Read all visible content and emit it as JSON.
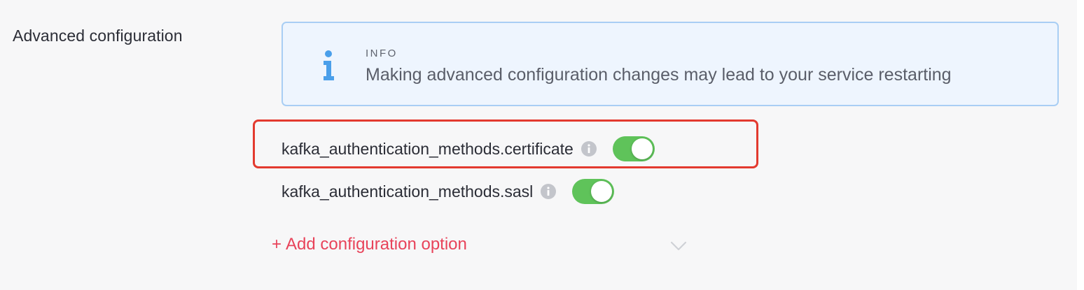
{
  "section": {
    "label": "Advanced configuration"
  },
  "info": {
    "title": "INFO",
    "message": "Making advanced configuration changes may lead to your service restarting",
    "icon": "info-icon"
  },
  "options": [
    {
      "label": "kafka_authentication_methods.certificate",
      "enabled": true,
      "hint_icon": "info-circle-icon"
    },
    {
      "label": "kafka_authentication_methods.sasl",
      "enabled": true,
      "hint_icon": "info-circle-icon"
    }
  ],
  "add_option": {
    "plus": "+",
    "label": "Add configuration option",
    "dropdown_icon": "chevron-down-icon"
  },
  "colors": {
    "info_accent": "#4a9fea",
    "toggle_on": "#5fc35a",
    "highlight": "#e33a2f",
    "link": "#e8435a"
  }
}
